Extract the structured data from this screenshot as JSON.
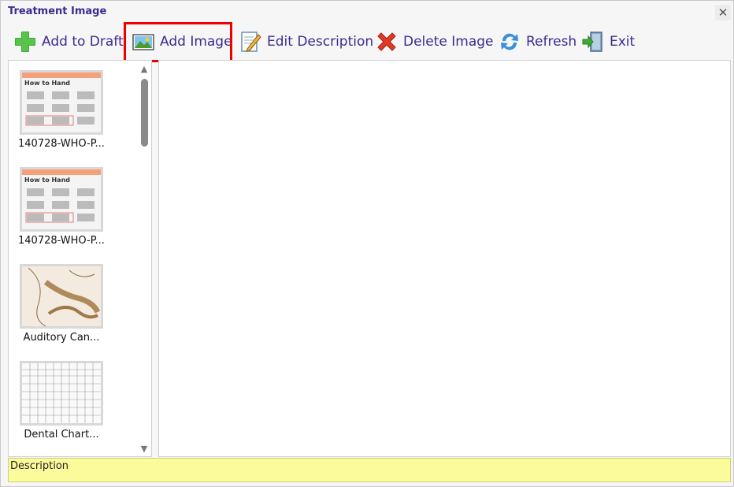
{
  "window": {
    "title": "Treatment Image",
    "close_symbol": "✕"
  },
  "toolbar": {
    "add_to_draft": "Add to Draft",
    "add_image": "Add Image",
    "edit_description": "Edit Description",
    "delete_image": "Delete Image",
    "refresh": "Refresh",
    "exit": "Exit"
  },
  "thumbnails": [
    {
      "label": "140728-WHO-P...",
      "header_text": "How to Hand"
    },
    {
      "label": "140728-WHO-P...",
      "header_text": "How to Hand"
    },
    {
      "label": "Auditory Can..."
    },
    {
      "label": "Dental Chart..."
    }
  ],
  "description": {
    "label": "Description"
  },
  "colors": {
    "title_text": "#3d2b8f",
    "highlight_border": "#ee0000",
    "description_bg": "#fbfb9c"
  }
}
